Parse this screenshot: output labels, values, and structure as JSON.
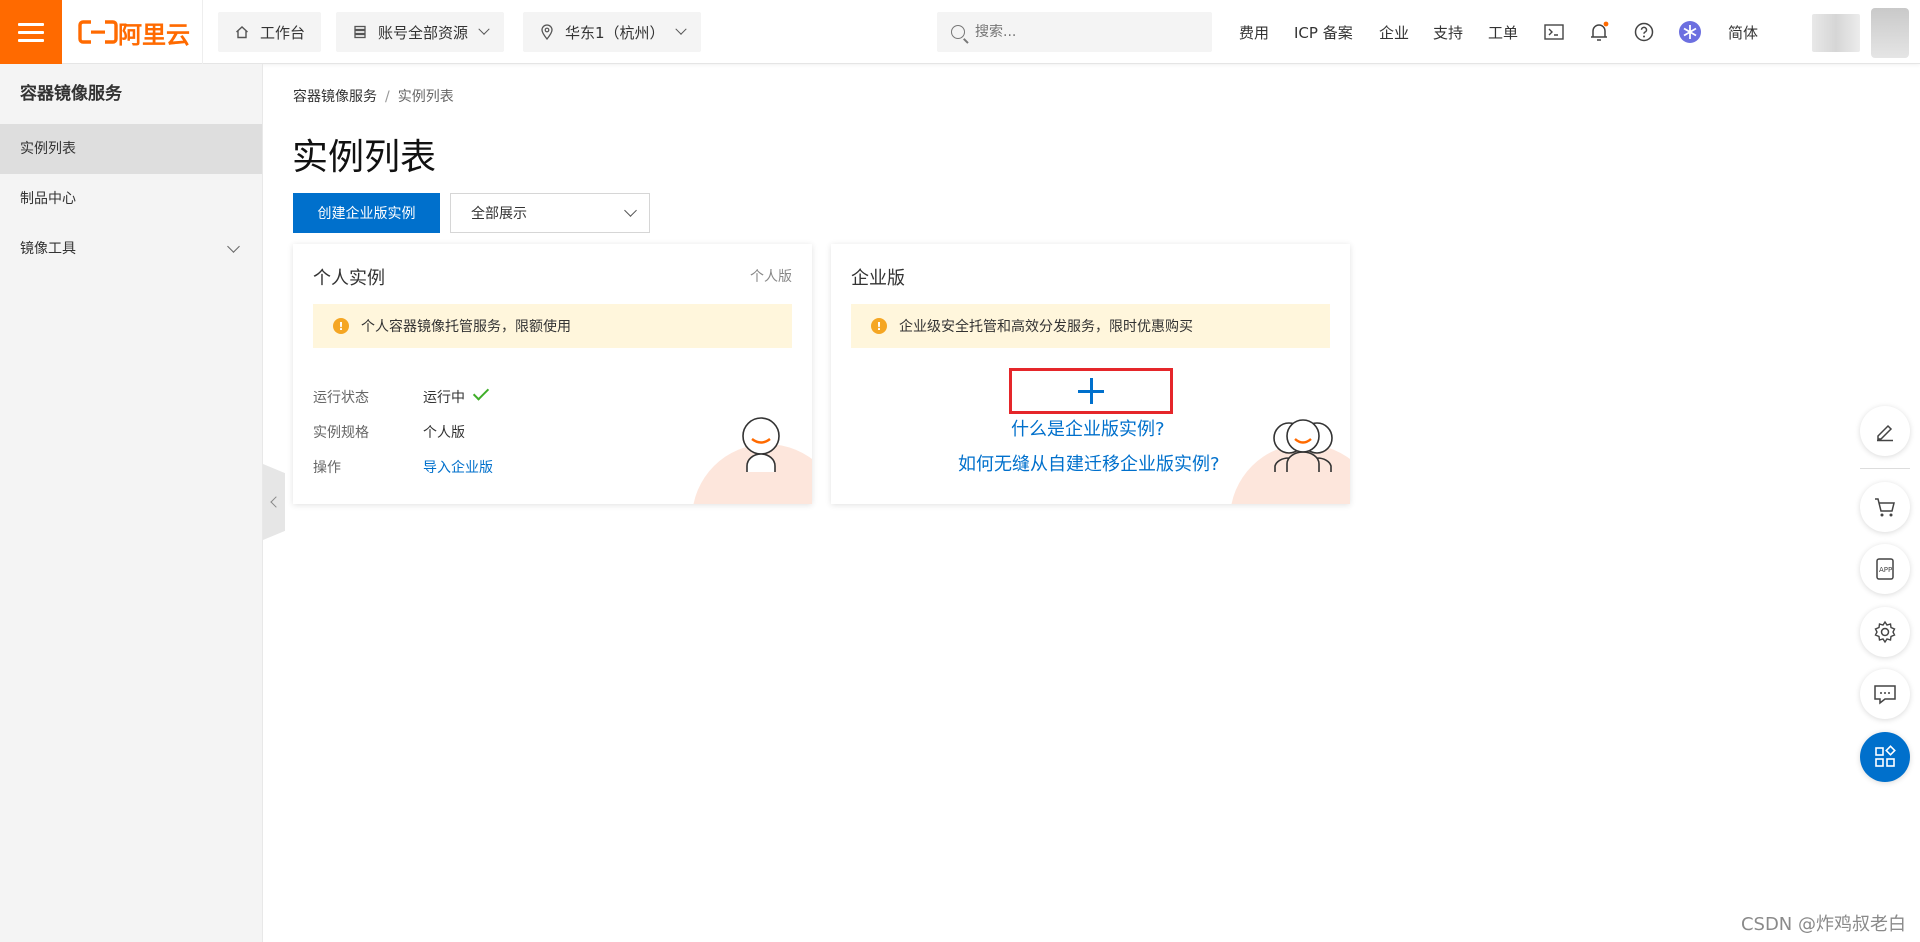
{
  "header": {
    "logo_text": "阿里云",
    "workbench": "工作台",
    "resources": "账号全部资源",
    "region": "华东1（杭州）",
    "search_placeholder": "搜索...",
    "links": [
      "费用",
      "ICP 备案",
      "企业",
      "支持",
      "工单"
    ],
    "lang": "简体"
  },
  "sidebar": {
    "title": "容器镜像服务",
    "items": [
      {
        "label": "实例列表"
      },
      {
        "label": "制品中心"
      },
      {
        "label": "镜像工具"
      }
    ]
  },
  "breadcrumb": {
    "root": "容器镜像服务",
    "sep": "/",
    "current": "实例列表"
  },
  "page": {
    "title": "实例列表",
    "create_button": "创建企业版实例",
    "filter_value": "全部展示"
  },
  "personal_card": {
    "title": "个人实例",
    "tag": "个人版",
    "notice": "个人容器镜像托管服务，限额使用",
    "rows": [
      {
        "key": "运行状态",
        "value": "运行中"
      },
      {
        "key": "实例规格",
        "value": "个人版"
      },
      {
        "key": "操作",
        "value": "导入企业版"
      }
    ]
  },
  "enterprise_card": {
    "title": "企业版",
    "notice": "企业级安全托管和高效分发服务，限时优惠购买",
    "link1": "什么是企业版实例?",
    "link2": "如何无缝从自建迁移企业版实例?"
  },
  "watermark": "CSDN @炸鸡叔老白",
  "colors": {
    "brand": "#ff6a00",
    "primary": "#0070cc",
    "highlight_box": "#e5262a",
    "success": "#3fae29"
  }
}
